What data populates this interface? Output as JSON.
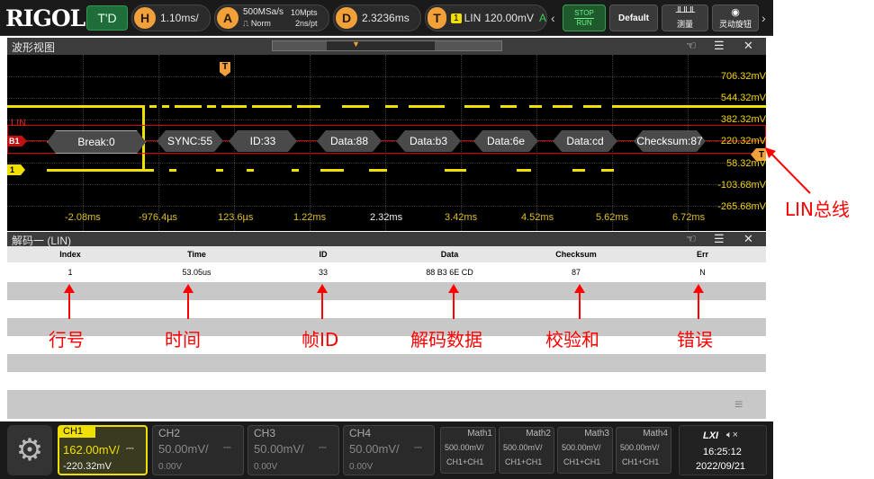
{
  "topbar": {
    "brand": "RIGOL",
    "mode": "T'D",
    "horizontal": {
      "icon": "H",
      "value": "1.10ms/"
    },
    "acquire": {
      "icon": "A",
      "rate": "500MSa/s",
      "mode": "Norm",
      "memory": "10Mpts",
      "resolution": "2ns/pt"
    },
    "delay": {
      "icon": "D",
      "value": "2.3236ms"
    },
    "trigger": {
      "icon": "T",
      "source": "1",
      "type": "LIN",
      "level": "120.00mV",
      "status": "A"
    },
    "stop_run": {
      "stop": "STOP",
      "run": "RUN"
    },
    "default_label": "Default",
    "measure_label": "测量",
    "knob_label": "灵动旋钮"
  },
  "wave_window": {
    "title": "波形视图",
    "lin_label": "LIN",
    "bus_tag": "B1",
    "ch1_tag": "1",
    "volt_labels": [
      "706.32mV",
      "544.32mV",
      "382.32mV",
      "220.32mV",
      "58.32mV",
      "-103.68mV",
      "-265.68mV"
    ],
    "time_labels": [
      "-2.08ms",
      "-976.4µs",
      "123.6µs",
      "1.22ms",
      "2.32ms",
      "3.42ms",
      "4.52ms",
      "5.62ms",
      "6.72ms"
    ],
    "decode_tags": [
      "Break:0",
      "SYNC:55",
      "ID:33",
      "Data:88",
      "Data:b3",
      "Data:6e",
      "Data:cd",
      "Checksum:87"
    ],
    "trigger_marker": "T"
  },
  "annotation_lin_bus": "LIN总线",
  "decode_window": {
    "title": "解码一 (LIN)",
    "columns": [
      "Index",
      "Time",
      "ID",
      "Data",
      "Checksum",
      "Err"
    ],
    "rows": [
      [
        "1",
        "53.05us",
        "33",
        "88 B3 6E CD",
        "87",
        "N"
      ]
    ],
    "annotations": [
      "行号",
      "时间",
      "帧ID",
      "解码数据",
      "校验和",
      "错误"
    ]
  },
  "bottombar": {
    "channels": [
      {
        "name": "CH1",
        "scale": "162.00mV/",
        "offset": "-220.32mV",
        "active": true
      },
      {
        "name": "CH2",
        "scale": "50.00mV/",
        "offset": "0.00V",
        "active": false
      },
      {
        "name": "CH3",
        "scale": "50.00mV/",
        "offset": "0.00V",
        "active": false
      },
      {
        "name": "CH4",
        "scale": "50.00mV/",
        "offset": "0.00V",
        "active": false
      }
    ],
    "maths": [
      {
        "name": "Math1",
        "scale": "500.00mV/",
        "expr": "CH1+CH1"
      },
      {
        "name": "Math2",
        "scale": "500.00mV/",
        "expr": "CH1+CH1"
      },
      {
        "name": "Math3",
        "scale": "500.00mV/",
        "expr": "CH1+CH1"
      },
      {
        "name": "Math4",
        "scale": "500.00mV/",
        "expr": "CH1+CH1"
      }
    ],
    "lxi": "LXI",
    "time": "16:25:12",
    "date": "2022/09/21"
  },
  "colors": {
    "ch1": "#f0e000",
    "accent": "#f2a03a",
    "annotation": "#ff0000"
  }
}
